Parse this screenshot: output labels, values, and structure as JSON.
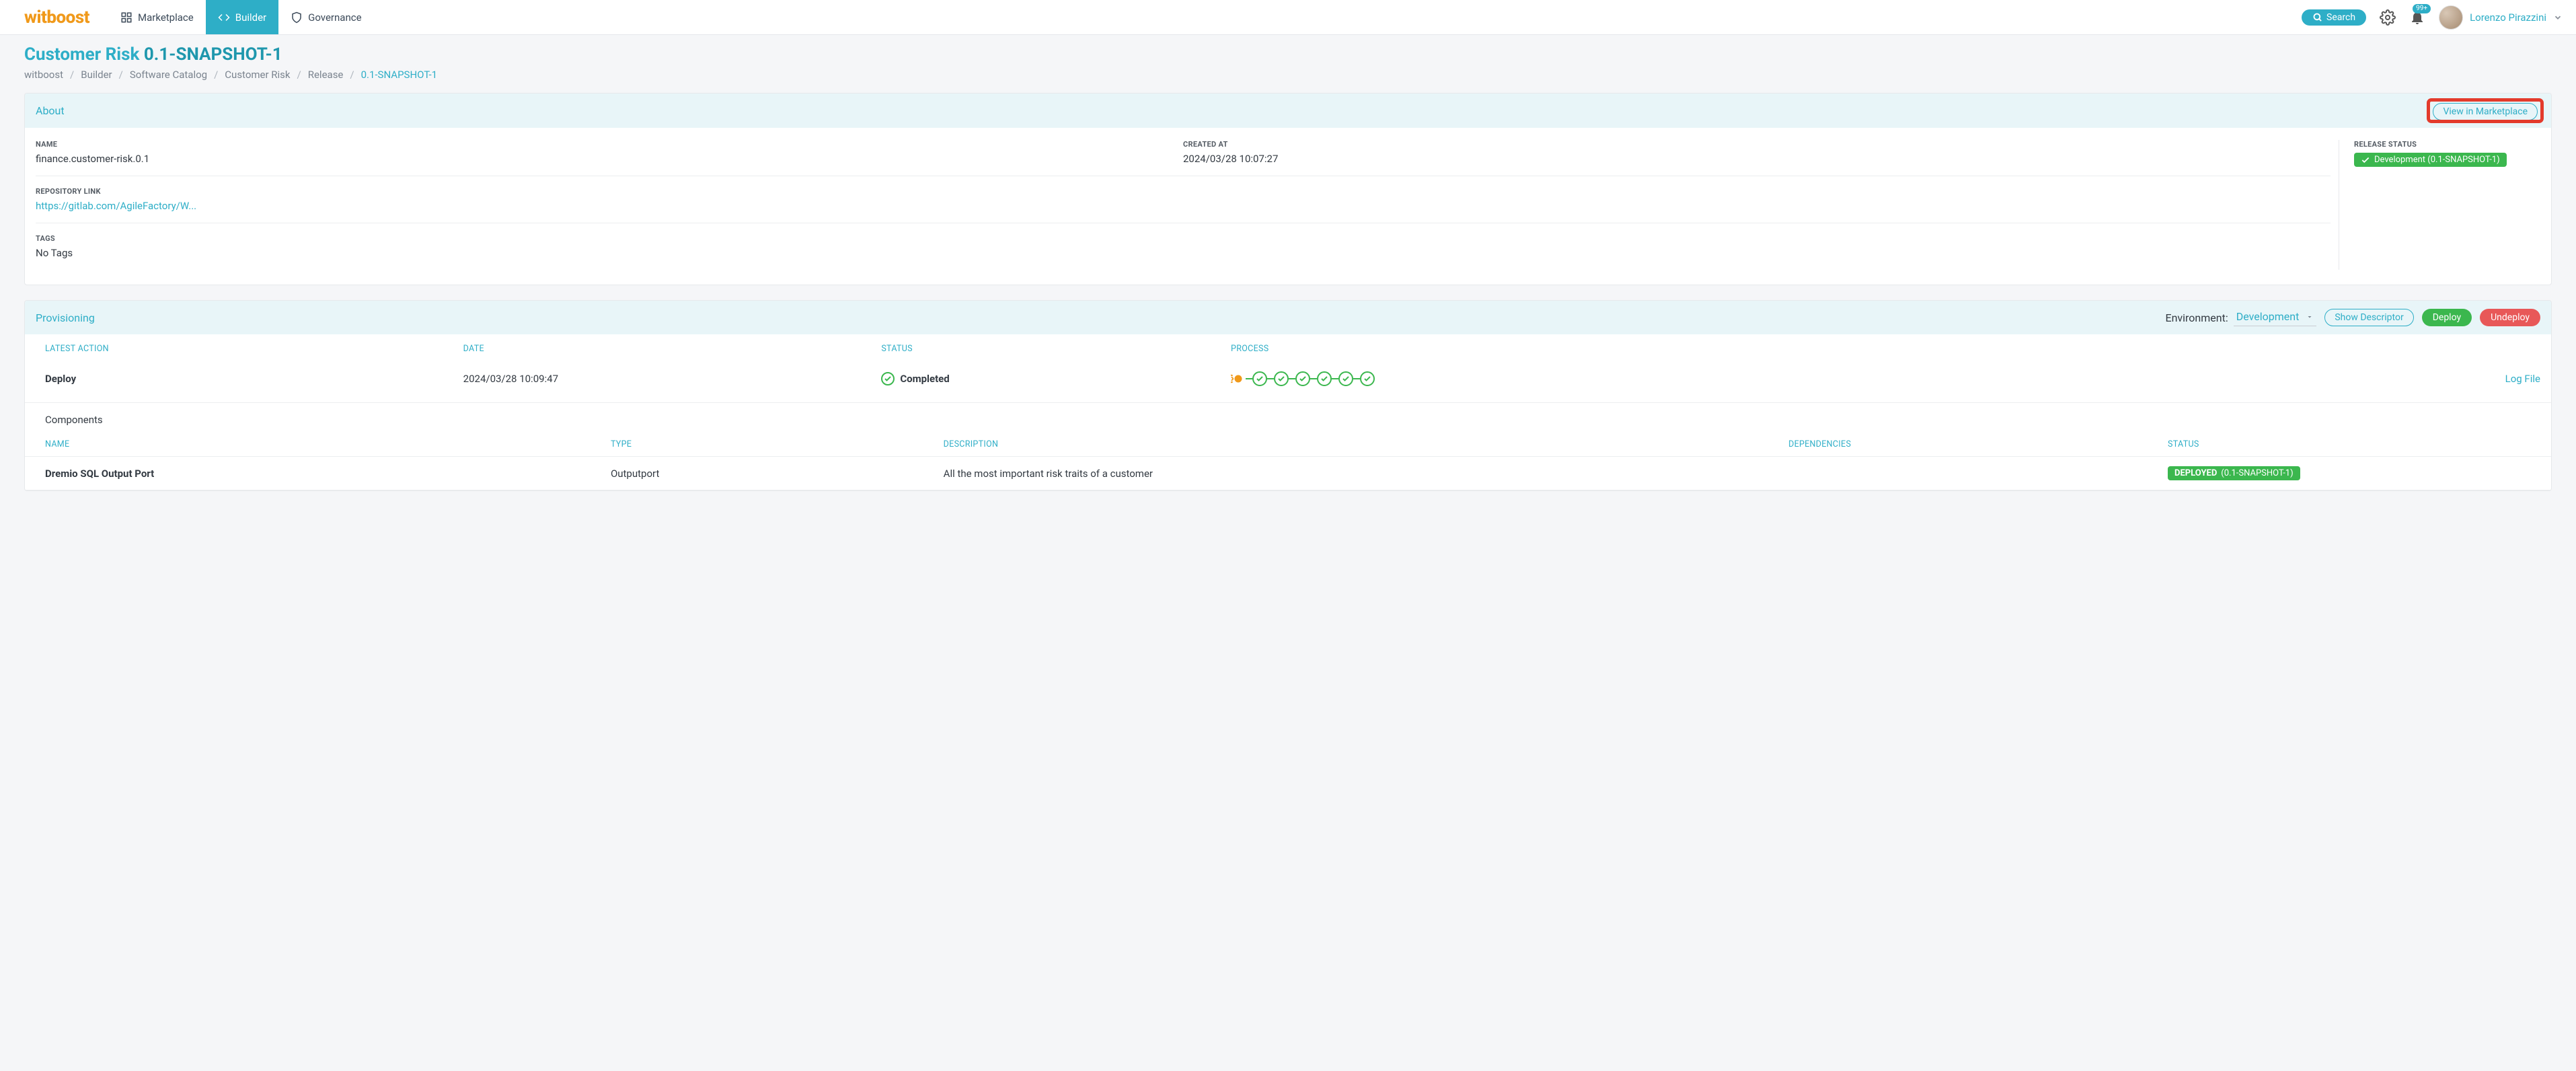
{
  "brand": "witboost",
  "nav": {
    "marketplace": "Marketplace",
    "builder": "Builder",
    "governance": "Governance"
  },
  "topbar": {
    "search": "Search",
    "notification_badge": "99+",
    "user_name": "Lorenzo Pirazzini"
  },
  "page": {
    "title_prefix": "Customer Risk ",
    "title_bold": "0.1-SNAPSHOT-1"
  },
  "breadcrumbs": [
    "witboost",
    "Builder",
    "Software Catalog",
    "Customer Risk",
    "Release",
    "0.1-SNAPSHOT-1"
  ],
  "about": {
    "header": "About",
    "view_marketplace": "View in Marketplace",
    "name_label": "NAME",
    "name_value": "finance.customer-risk.0.1",
    "created_label": "CREATED AT",
    "created_value": "2024/03/28 10:07:27",
    "repo_label": "REPOSITORY LINK",
    "repo_value": "https://gitlab.com/AgileFactory/W...",
    "tags_label": "TAGS",
    "tags_value": "No Tags",
    "release_status_label": "RELEASE STATUS",
    "release_status_value": "Development (0.1-SNAPSHOT-1)"
  },
  "provisioning": {
    "header": "Provisioning",
    "env_label": "Environment:",
    "env_value": "Development",
    "show_descriptor": "Show Descriptor",
    "deploy": "Deploy",
    "undeploy": "Undeploy",
    "columns": {
      "latest_action": "LATEST ACTION",
      "date": "DATE",
      "status": "STATUS",
      "process": "PROCESS"
    },
    "row": {
      "action": "Deploy",
      "date": "2024/03/28 10:09:47",
      "status": "Completed",
      "log_file": "Log File"
    },
    "components": {
      "title": "Components",
      "columns": {
        "name": "NAME",
        "type": "TYPE",
        "description": "DESCRIPTION",
        "dependencies": "DEPENDENCIES",
        "status": "STATUS"
      },
      "row": {
        "name": "Dremio SQL Output Port",
        "type": "Outputport",
        "description": "All the most important risk traits of a customer",
        "dependencies": "",
        "status_label": "DEPLOYED",
        "status_suffix": "(0.1-SNAPSHOT-1)"
      }
    }
  }
}
